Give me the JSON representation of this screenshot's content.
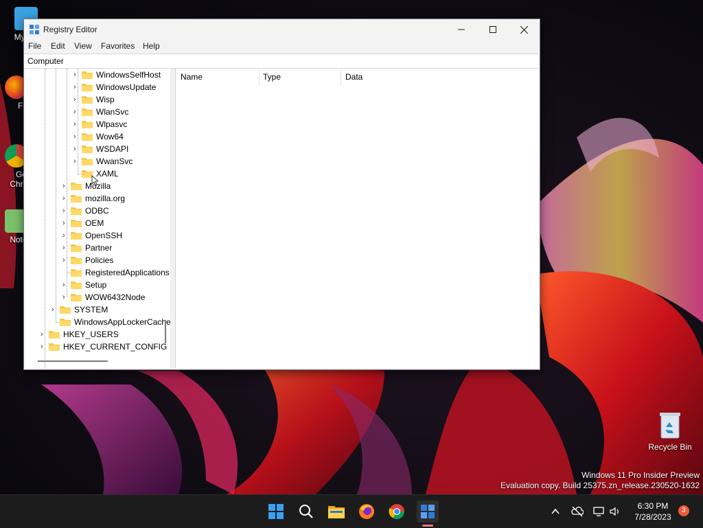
{
  "desktop": {
    "icons": [
      {
        "label": "My Co",
        "icon": "computer-icon"
      },
      {
        "label": "Fir",
        "icon": "firefox-icon"
      },
      {
        "label": "Go\nChr",
        "icon": "chrome-icon"
      },
      {
        "label": "Note",
        "icon": "notepad-icon"
      },
      {
        "label": "Recycle Bin",
        "icon": "recycle-bin-icon"
      }
    ],
    "watermark_line1": "Windows 11 Pro Insider Preview",
    "watermark_line2": "Evaluation copy. Build 25375.zn_release.230520-1632"
  },
  "window": {
    "title": "Registry Editor",
    "menu": [
      "File",
      "Edit",
      "View",
      "Favorites",
      "Help"
    ],
    "address": "Computer",
    "tree": [
      {
        "label": "WindowsSelfHost"
      },
      {
        "label": "WindowsUpdate"
      },
      {
        "label": "Wisp"
      },
      {
        "label": "WlanSvc"
      },
      {
        "label": "Wlpasvc"
      },
      {
        "label": "Wow64"
      },
      {
        "label": "WSDAPI"
      },
      {
        "label": "WwanSvc"
      },
      {
        "label": "XAML"
      },
      {
        "label": "Mozilla"
      },
      {
        "label": "mozilla.org"
      },
      {
        "label": "ODBC"
      },
      {
        "label": "OEM"
      },
      {
        "label": "OpenSSH"
      },
      {
        "label": "Partner"
      },
      {
        "label": "Policies"
      },
      {
        "label": "RegisteredApplications"
      },
      {
        "label": "Setup"
      },
      {
        "label": "WOW6432Node"
      },
      {
        "label": "SYSTEM"
      },
      {
        "label": "WindowsAppLockerCache"
      },
      {
        "label": "HKEY_USERS"
      },
      {
        "label": "HKEY_CURRENT_CONFIG"
      }
    ],
    "columns": [
      "Name",
      "Type",
      "Data"
    ]
  },
  "taskbar": {
    "apps": [
      "start-icon",
      "search-icon",
      "file-explorer-icon",
      "firefox-icon",
      "chrome-icon",
      "registry-editor-icon"
    ],
    "time": "6:30 PM",
    "date": "7/28/2023",
    "notification_count": "3"
  },
  "colors": {
    "folder": "#f4c84a",
    "accent": "#0067c0",
    "taskbar": "#1c1c1c"
  }
}
